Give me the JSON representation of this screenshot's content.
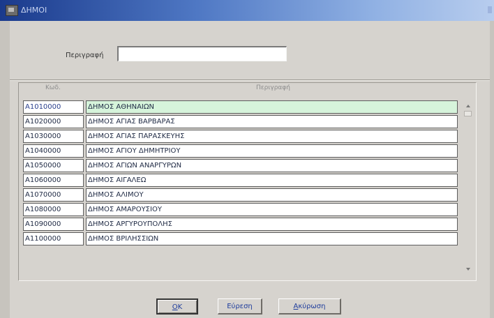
{
  "window": {
    "title": "ΔΗΜΟΙ"
  },
  "search": {
    "label": "Περιγραφή",
    "value": "",
    "placeholder": ""
  },
  "grid": {
    "headers": {
      "code": "Κωδ.",
      "description": "Περιγραφή"
    },
    "rows": [
      {
        "code": "A1010000",
        "description": "ΔΗΜΟΣ ΑΘΗΝΑΙΩΝ"
      },
      {
        "code": "A1020000",
        "description": "ΔΗΜΟΣ ΑΓΙΑΣ ΒΑΡΒΑΡΑΣ"
      },
      {
        "code": "A1030000",
        "description": "ΔΗΜΟΣ ΑΓΙΑΣ ΠΑΡΑΣΚΕΥΗΣ"
      },
      {
        "code": "A1040000",
        "description": "ΔΗΜΟΣ ΑΓΙΟΥ ΔΗΜΗΤΡΙΟΥ"
      },
      {
        "code": "A1050000",
        "description": "ΔΗΜΟΣ ΑΓΙΩΝ ΑΝΑΡΓΥΡΩΝ"
      },
      {
        "code": "A1060000",
        "description": "ΔΗΜΟΣ ΑΙΓΑΛΕΩ"
      },
      {
        "code": "A1070000",
        "description": "ΔΗΜΟΣ ΑΛΙΜΟΥ"
      },
      {
        "code": "A1080000",
        "description": "ΔΗΜΟΣ ΑΜΑΡΟΥΣΙΟΥ"
      },
      {
        "code": "A1090000",
        "description": "ΔΗΜΟΣ ΑΡΓΥΡΟΥΠΟΛΗΣ"
      },
      {
        "code": "A1100000",
        "description": "ΔΗΜΟΣ ΒΡΙΛΗΣΣΙΩΝ"
      }
    ],
    "selected_index": 0
  },
  "buttons": {
    "ok": {
      "mnemonic": "O",
      "rest": "K"
    },
    "find": {
      "mnemonic": "",
      "rest": "Εύρεση"
    },
    "cancel": {
      "mnemonic": "Α",
      "rest": "κύρωση"
    }
  },
  "colors": {
    "selected_row": "#d6f4db",
    "button_text": "#1f3d9c",
    "title_gradient_start": "#1a3a8c"
  },
  "icons": {
    "window": "app-window-icon",
    "scroll_up": "arrow-up-icon",
    "scroll_down": "arrow-down-icon"
  }
}
